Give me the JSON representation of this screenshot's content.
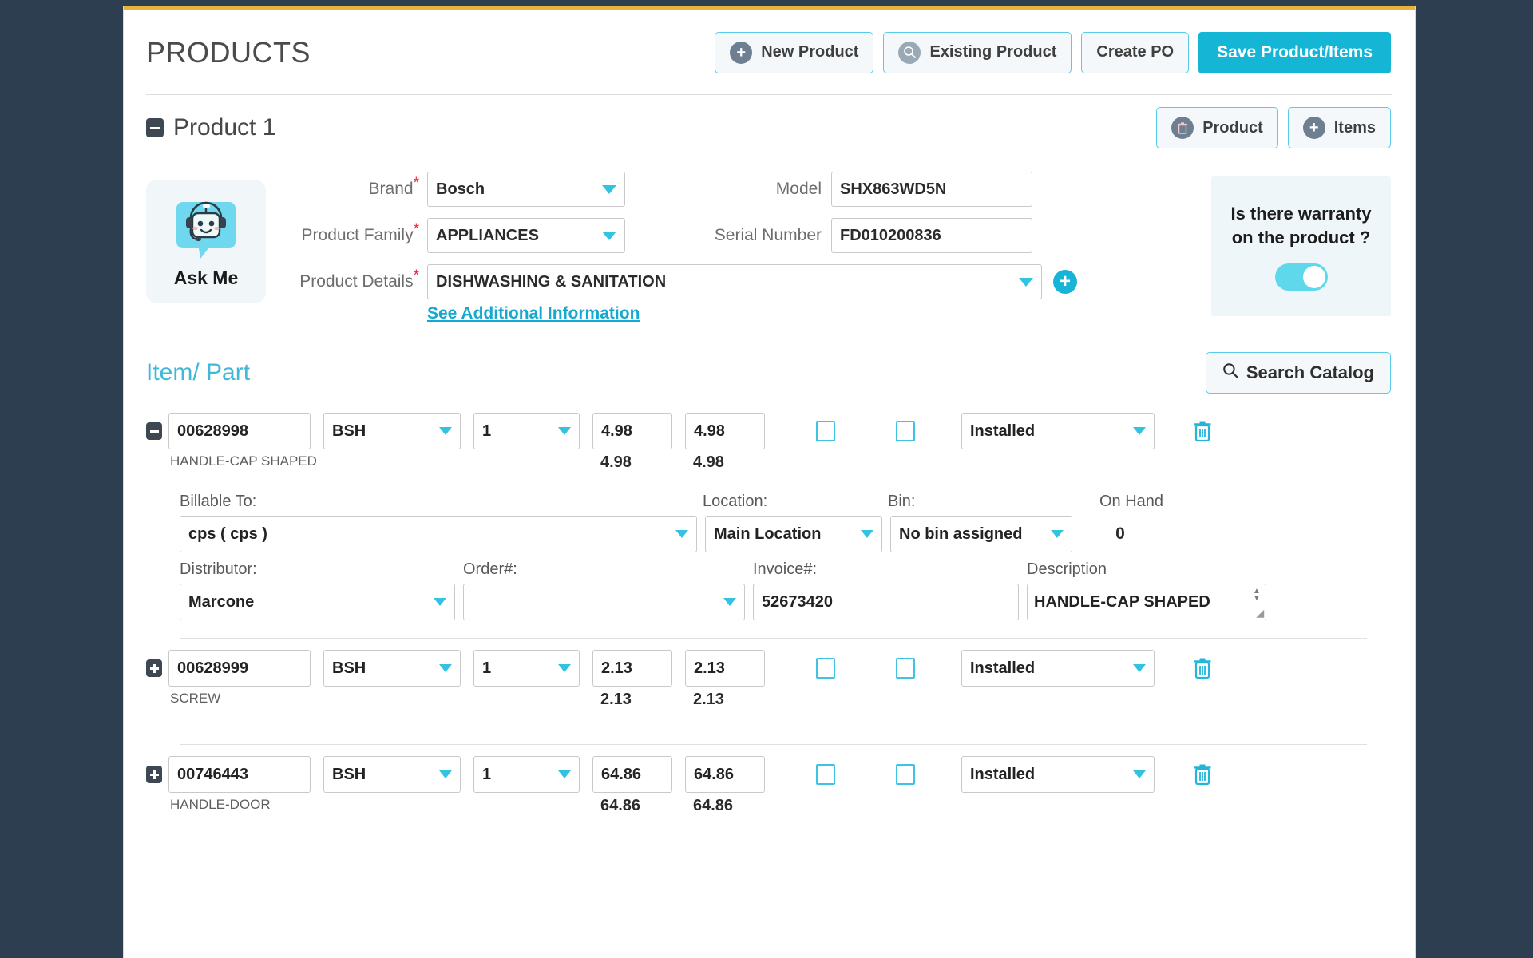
{
  "header": {
    "title": "PRODUCTS",
    "buttons": [
      {
        "label": "New Product",
        "icon": "plus-circle-icon"
      },
      {
        "label": "Existing Product",
        "icon": "magnifier-circle-icon"
      },
      {
        "label": "Create PO",
        "icon": "none"
      }
    ],
    "save_label": "Save Product/Items"
  },
  "product_section": {
    "title": "Product 1",
    "collapse_state": "expanded",
    "buttons": [
      {
        "label": "Product",
        "icon": "trash-circle-icon"
      },
      {
        "label": "Items",
        "icon": "plus-circle-icon"
      }
    ],
    "askme": {
      "label": "Ask Me",
      "icon": "robot-chat-icon"
    },
    "fields": {
      "brand_label": "Brand",
      "brand_value": "Bosch",
      "family_label": "Product Family",
      "family_value": "APPLIANCES",
      "details_label": "Product Details",
      "details_value": "DISHWASHING & SANITATION",
      "model_label": "Model",
      "model_value": "SHX863WD5N",
      "serial_label": "Serial Number",
      "serial_value": "FD010200836",
      "additional_link": "See Additional Information"
    },
    "warranty": {
      "question": "Is there warranty on the product ?",
      "toggle_on": true
    }
  },
  "item_part": {
    "title": "Item/ Part",
    "search_label": "Search Catalog",
    "rows": [
      {
        "expanded": true,
        "part_number": "00628998",
        "description": "HANDLE-CAP SHAPED",
        "vendor": "BSH",
        "qty": "1",
        "price": "4.98",
        "price_sub": "4.98",
        "total": "4.98",
        "total_sub": "4.98",
        "check1": false,
        "check2": false,
        "status": "Installed",
        "detail": {
          "billable_label": "Billable To:",
          "billable_value": "cps ( cps )",
          "location_label": "Location:",
          "location_value": "Main Location",
          "bin_label": "Bin:",
          "bin_value": "No bin assigned",
          "onhand_label": "On Hand",
          "onhand_value": "0",
          "distributor_label": "Distributor:",
          "distributor_value": "Marcone",
          "order_label": "Order#:",
          "order_value": "",
          "invoice_label": "Invoice#:",
          "invoice_value": "52673420",
          "desc_label": "Description",
          "desc_value": "HANDLE-CAP SHAPED"
        }
      },
      {
        "expanded": false,
        "part_number": "00628999",
        "description": "SCREW",
        "vendor": "BSH",
        "qty": "1",
        "price": "2.13",
        "price_sub": "2.13",
        "total": "2.13",
        "total_sub": "2.13",
        "check1": false,
        "check2": false,
        "status": "Installed"
      },
      {
        "expanded": false,
        "part_number": "00746443",
        "description": "HANDLE-DOOR",
        "vendor": "BSH",
        "qty": "1",
        "price": "64.86",
        "price_sub": "64.86",
        "total": "64.86",
        "total_sub": "64.86",
        "check1": false,
        "check2": false,
        "status": "Installed"
      }
    ]
  },
  "colors": {
    "accent": "#15b5d6",
    "accent_border": "#58cbe8",
    "title_gray": "#4b4b4b",
    "required_red": "#e8273a",
    "top_bar": "#e8b33a",
    "page_backdrop": "#2c3e50"
  }
}
